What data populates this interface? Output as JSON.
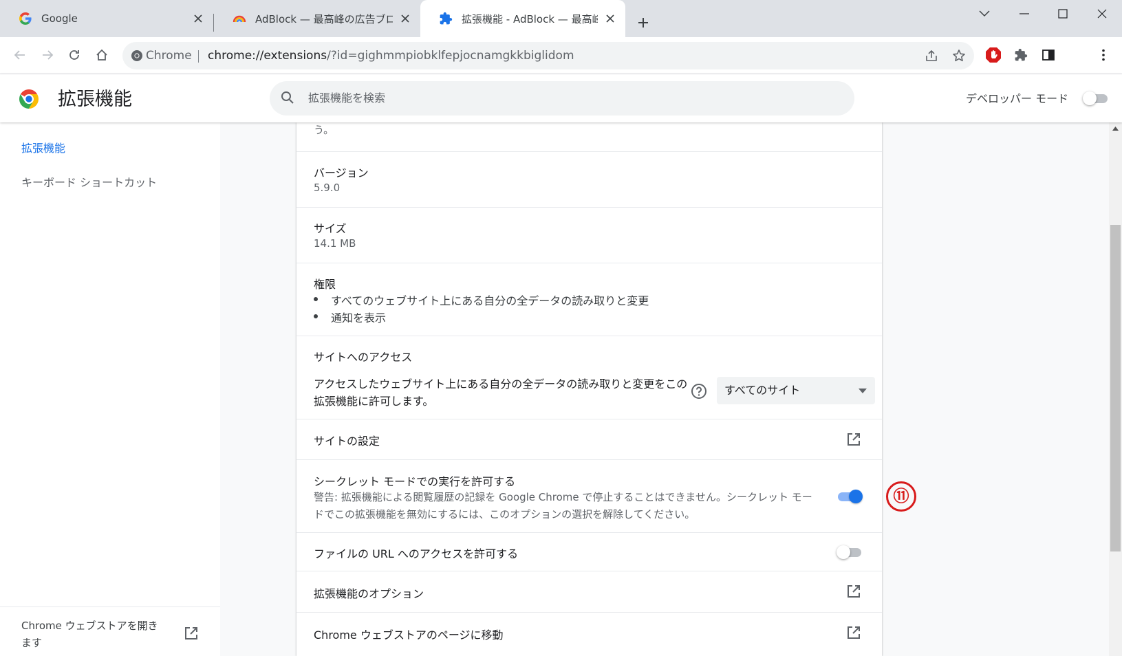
{
  "tabs": [
    {
      "label": "Google",
      "icon": "google-g-icon"
    },
    {
      "label": "AdBlock — 最高峰の広告ブロッカー",
      "icon": "adblock-rainbow-icon"
    },
    {
      "label": "拡張機能 - AdBlock — 最高峰の広",
      "icon": "puzzle-icon",
      "active": true
    }
  ],
  "omnibox": {
    "site_label": "Chrome",
    "url_host": "chrome://extensions",
    "url_path": "/?id=gighmmpiobklfepjocnamgkkbiglidom"
  },
  "header": {
    "title": "拡張機能",
    "search_placeholder": "拡張機能を検索",
    "dev_mode_label": "デベロッパー モード",
    "dev_mode_on": false
  },
  "sidebar": {
    "items": [
      {
        "label": "拡張機能",
        "selected": true
      },
      {
        "label": "キーボード ショートカット",
        "selected": false
      }
    ],
    "webstore_label": "Chrome ウェブストアを開きます"
  },
  "details": {
    "truncated_text": "う。",
    "version_label": "バージョン",
    "version_value": "5.9.0",
    "size_label": "サイズ",
    "size_value": "14.1 MB",
    "permissions_label": "権限",
    "permissions": [
      "すべてのウェブサイト上にある自分の全データの読み取りと変更",
      "通知を表示"
    ],
    "site_access_label": "サイトへのアクセス",
    "site_access_desc": "アクセスしたウェブサイト上にある自分の全データの読み取りと変更をこの拡張機能に許可します。",
    "site_access_value": "すべてのサイト",
    "site_settings_label": "サイトの設定",
    "incognito_label": "シークレット モードでの実行を許可する",
    "incognito_warning": "警告: 拡張機能による閲覧履歴の記録を Google Chrome で停止することはできません。シークレット モードでこの拡張機能を無効にするには、このオプションの選択を解除してください。",
    "incognito_on": true,
    "file_url_label": "ファイルの URL へのアクセスを許可する",
    "file_url_on": false,
    "options_label": "拡張機能のオプション",
    "webstore_page_label": "Chrome ウェブストアのページに移動"
  },
  "annotation": {
    "label": "⑪",
    "color": "#d81b1b"
  },
  "colors": {
    "accent": "#1a73e8",
    "tabstrip": "#dee1e6",
    "content_bg": "#f8f9fa"
  }
}
